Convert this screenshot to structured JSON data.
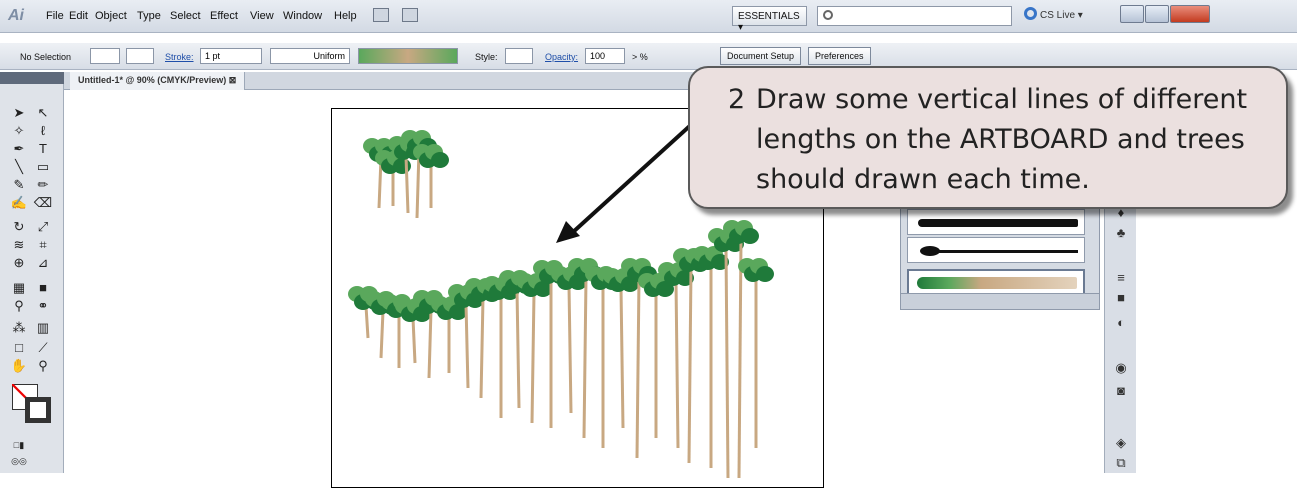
{
  "app_logo": "Ai",
  "menu": [
    "File",
    "Edit",
    "Object",
    "Type",
    "Select",
    "Effect",
    "View",
    "Window",
    "Help"
  ],
  "workspace": "ESSENTIALS ▾",
  "cs_live": "CS Live ▾",
  "control_bar": {
    "selection": "No Selection",
    "stroke_label": "Stroke:",
    "stroke_value": "1 pt",
    "profile": "Uniform",
    "style_label": "Style:",
    "opacity_label": "Opacity:",
    "opacity_value": "100",
    "opacity_unit": "> %",
    "document_setup": "Document Setup",
    "preferences": "Preferences"
  },
  "document_tab": "Untitled-1* @ 90% (CMYK/Preview) ⊠",
  "callout": {
    "number": "2",
    "text": "Draw some vertical lines of different lengths on the ARTBOARD and trees should drawn each time."
  },
  "colors": {
    "tree_dark": "#1f7a3a",
    "tree_light": "#5aa85c",
    "trunk": "#c8a882",
    "callout_bg": "#ebe0df",
    "menubar": "#dde3ea"
  },
  "icons": [
    "search-icon",
    "cs-live-icon",
    "minimize-icon",
    "maximize-icon",
    "close-icon",
    "selection-tool-icon",
    "pen-tool-icon",
    "type-tool-icon",
    "line-tool-icon",
    "brush-tool-icon",
    "zoom-tool-icon",
    "fill-stroke-icon"
  ]
}
